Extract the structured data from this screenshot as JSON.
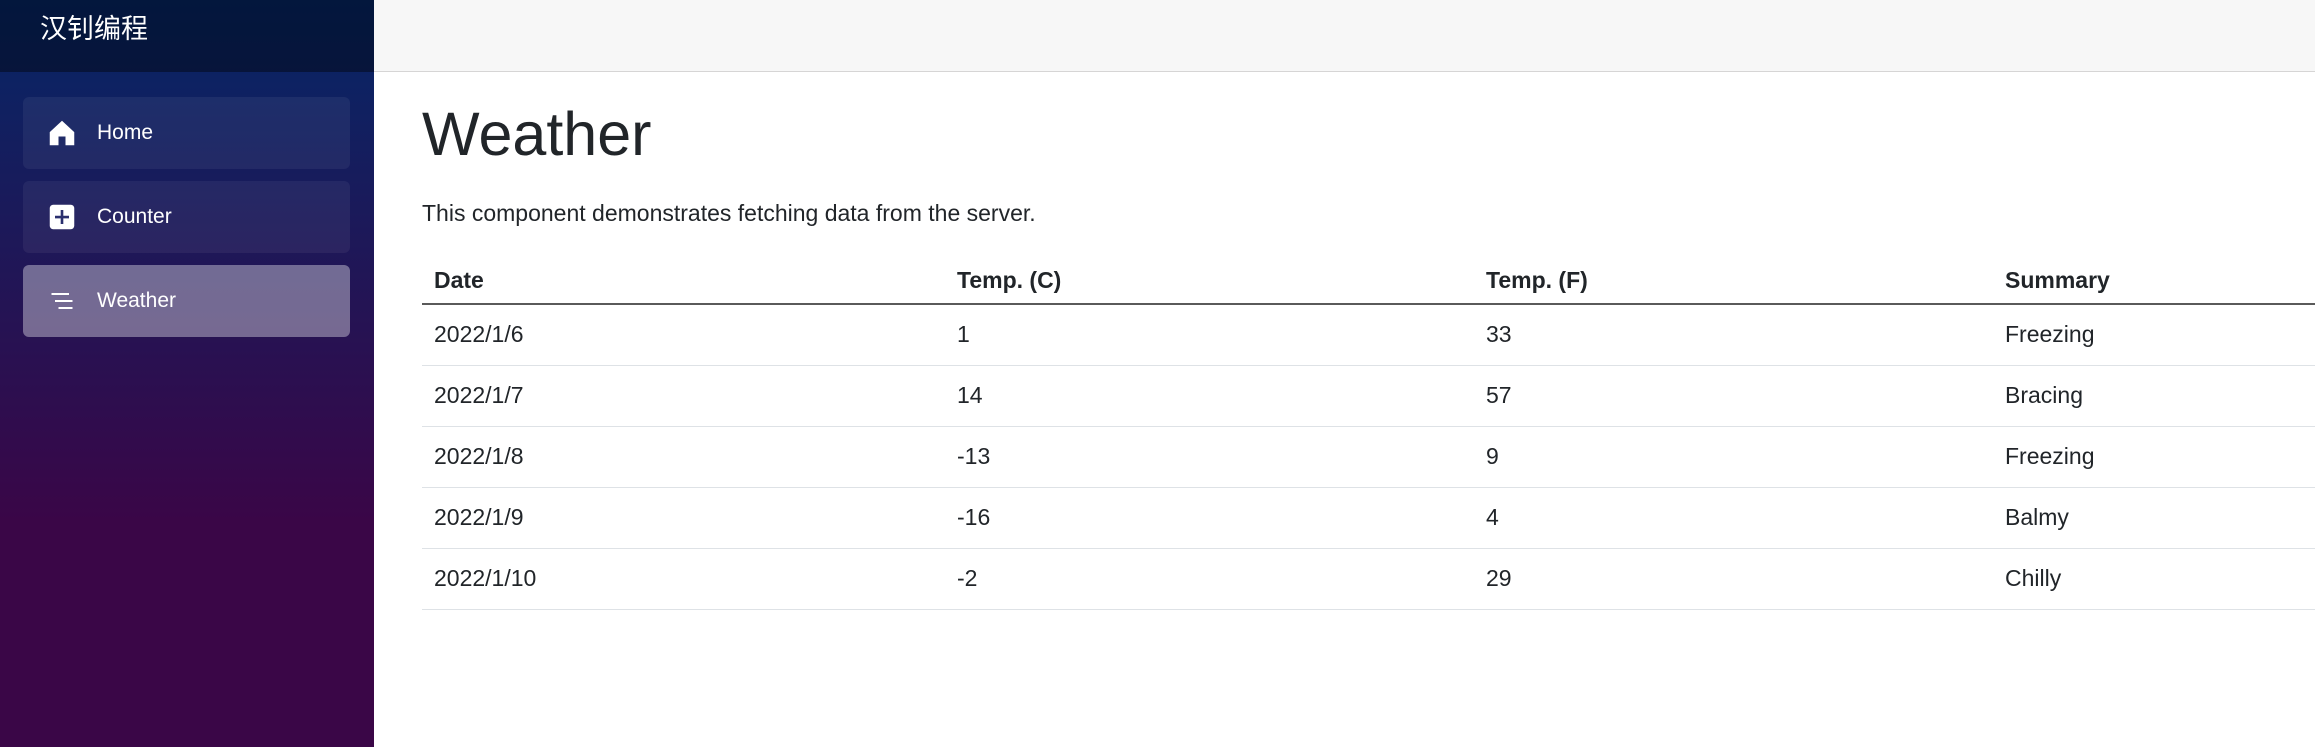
{
  "brand": "汉钊编程",
  "nav": [
    {
      "label": "Home",
      "icon": "home-icon",
      "active": false
    },
    {
      "label": "Counter",
      "icon": "plus-square-icon",
      "active": false
    },
    {
      "label": "Weather",
      "icon": "list-icon",
      "active": true
    }
  ],
  "page": {
    "title": "Weather",
    "description": "This component demonstrates fetching data from the server."
  },
  "table": {
    "headers": [
      "Date",
      "Temp. (C)",
      "Temp. (F)",
      "Summary"
    ],
    "rows": [
      [
        "2022/1/6",
        "1",
        "33",
        "Freezing"
      ],
      [
        "2022/1/7",
        "14",
        "57",
        "Bracing"
      ],
      [
        "2022/1/8",
        "-13",
        "9",
        "Freezing"
      ],
      [
        "2022/1/9",
        "-16",
        "4",
        "Balmy"
      ],
      [
        "2022/1/10",
        "-2",
        "29",
        "Chilly"
      ]
    ]
  },
  "colors": {
    "sidebar_top": "#052767",
    "sidebar_bottom": "#3a0647",
    "active_nav": "#6e6e9a"
  }
}
